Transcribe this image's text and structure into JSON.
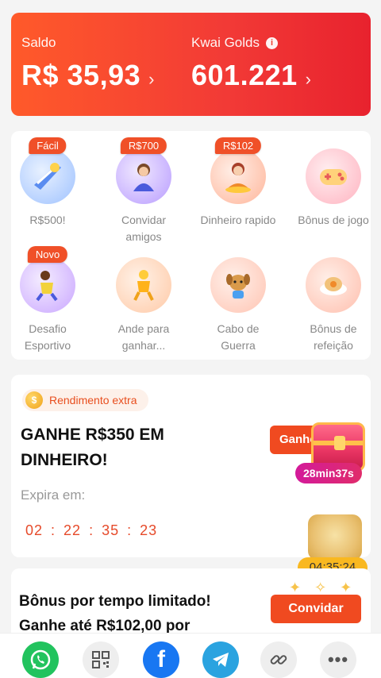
{
  "balance": {
    "saldo_label": "Saldo",
    "saldo_value": "R$ 35,93",
    "golds_label": "Kwai Golds",
    "golds_value": "601.221",
    "info_icon": "info-icon",
    "chevron": "›"
  },
  "tasks": [
    {
      "label": "R$500!",
      "badge": "Fácil",
      "icon": "rocket-icon",
      "color": "#cfe3ff"
    },
    {
      "label": "Convidar amigos",
      "badge": "R$700",
      "icon": "person-icon",
      "color": "#d8c8ff"
    },
    {
      "label": "Dinheiro rapido",
      "badge": "R$102",
      "icon": "money-woman-icon",
      "color": "#ffd8cc"
    },
    {
      "label": "Bônus de jogo",
      "badge": "",
      "icon": "gamepad-icon",
      "color": "#ffd6dc"
    },
    {
      "label": "Desafio Esportivo",
      "badge": "Novo",
      "icon": "runner-icon",
      "color": "#e4d0ff"
    },
    {
      "label": "Ande para ganhar...",
      "badge": "",
      "icon": "walker-icon",
      "color": "#ffe6d2"
    },
    {
      "label": "Cabo de Guerra",
      "badge": "",
      "icon": "dog-icon",
      "color": "#ffe6dc"
    },
    {
      "label": "Bônus de refeição",
      "badge": "",
      "icon": "meal-icon",
      "color": "#ffdfd6"
    }
  ],
  "extra": {
    "pill_label": "Rendimento extra",
    "coin_symbol": "$",
    "headline": "GANHE R$350 EM DINHEIRO!",
    "expira_label": "Expira em:",
    "timer": [
      "02",
      "22",
      "35",
      "23"
    ],
    "timer_sep": ":",
    "ganhe_label": "Ganhe",
    "chest_countdown": "28min37s"
  },
  "meal_float": {
    "time": "04:35:24"
  },
  "bonus": {
    "title": "Bônus por tempo limitado! Ganhe até R$102,00 por",
    "button": "Convidar"
  },
  "share": {
    "more": "•••",
    "facebook": "f"
  }
}
